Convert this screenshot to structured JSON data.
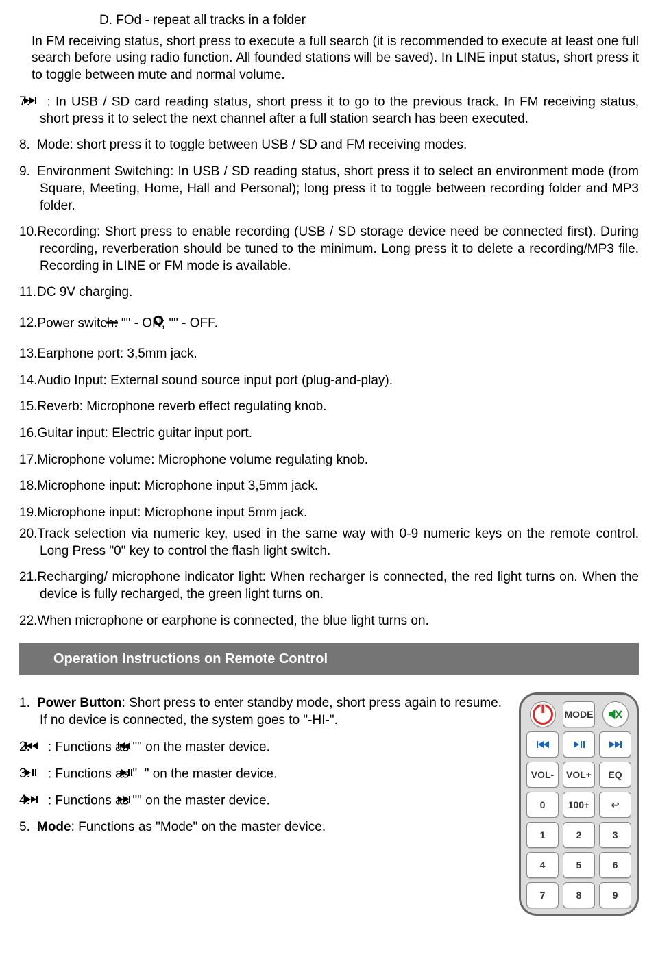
{
  "topD": {
    "label": "D.",
    "text": "FOd - repeat all tracks in a folder"
  },
  "fmPara": "In FM receiving status, short press to execute a full search (it is recommended to execute at least one full search before using radio function. All founded stations will be saved). In LINE input status, short press it to toggle between mute and normal volume.",
  "i7": {
    "num": "7.",
    "text": ": In USB / SD card reading status, short press it to go to the previous track. In FM receiving status, short press it to select the next channel after a full station search has been executed."
  },
  "i8": {
    "num": "8.",
    "text": "Mode: short press it to toggle between USB / SD and FM receiving modes."
  },
  "i9": {
    "num": "9.",
    "text": "Environment Switching: In USB / SD reading status, short press it to select an environment mode (from Square, Meeting, Home, Hall and Personal); long press it to toggle between recording folder and MP3 folder."
  },
  "i10": {
    "num": "10.",
    "text": "Recording: Short press to enable recording (USB / SD storage device need be connected first). During recording, reverberation should be tuned to the minimum. Long press it to delete a recording/MP3 file. Recording in LINE or FM mode is available."
  },
  "i11": {
    "num": "11.",
    "text": "DC 9V charging."
  },
  "i12": {
    "num": "12.",
    "pre": "Power switch: \"",
    "mid": "\" - ON; \"",
    "post": "\" - OFF."
  },
  "i13": {
    "num": "13.",
    "text": "Earphone port: 3,5mm jack."
  },
  "i14": {
    "num": "14.",
    "text": "Audio Input: External sound source input port (plug-and-play)."
  },
  "i15": {
    "num": "15.",
    "text": "Reverb: Microphone reverb effect regulating knob."
  },
  "i16": {
    "num": "16.",
    "text": "Guitar input: Electric guitar input port."
  },
  "i17": {
    "num": "17.",
    "text": "Microphone volume: Microphone volume regulating knob."
  },
  "i18": {
    "num": "18.",
    "text": "Microphone input: Microphone input 3,5mm jack."
  },
  "i19": {
    "num": "19.",
    "text": "Microphone input: Microphone input 5mm jack."
  },
  "i20": {
    "num": "20.",
    "text": "Track selection via numeric key, used in the same way with 0-9 numeric keys on the remote control. Long Press \"0\" key to control the flash light switch."
  },
  "i21": {
    "num": "21.",
    "text": "Recharging/ microphone indicator light: When recharger is connected, the red light turns on. When the device is fully recharged, the green light turns on."
  },
  "i22": {
    "num": "22.",
    "text": "When microphone or earphone is connected, the blue light turns on."
  },
  "sectionHeader": "Operation Instructions on Remote Control",
  "r1": {
    "num": "1.",
    "boldLabel": "Power Button",
    "text": ": Short press to enter standby mode, short press again to resume. If no device is connected, the system goes to \"-HI-\"."
  },
  "r2": {
    "num": "2.",
    "pre": ": Functions as \"",
    "post": "\" on the master device."
  },
  "r3": {
    "num": "3.",
    "pre": ": Functions as \"",
    "post": "\" on the master device."
  },
  "r4": {
    "num": "4.",
    "pre": ": Functions as \"",
    "post": "\" on the master device."
  },
  "r5": {
    "num": "5.",
    "boldLabel": "Mode",
    "text": ": Functions as \"Mode\" on the master device."
  },
  "remote": {
    "row1": [
      "",
      "MODE",
      ""
    ],
    "row2": [
      "",
      "",
      ""
    ],
    "row3": [
      "VOL-",
      "VOL+",
      "EQ"
    ],
    "row4": [
      "0",
      "100+",
      "↩"
    ],
    "row5": [
      "1",
      "2",
      "3"
    ],
    "row6": [
      "4",
      "5",
      "6"
    ],
    "row7": [
      "7",
      "8",
      "9"
    ]
  }
}
